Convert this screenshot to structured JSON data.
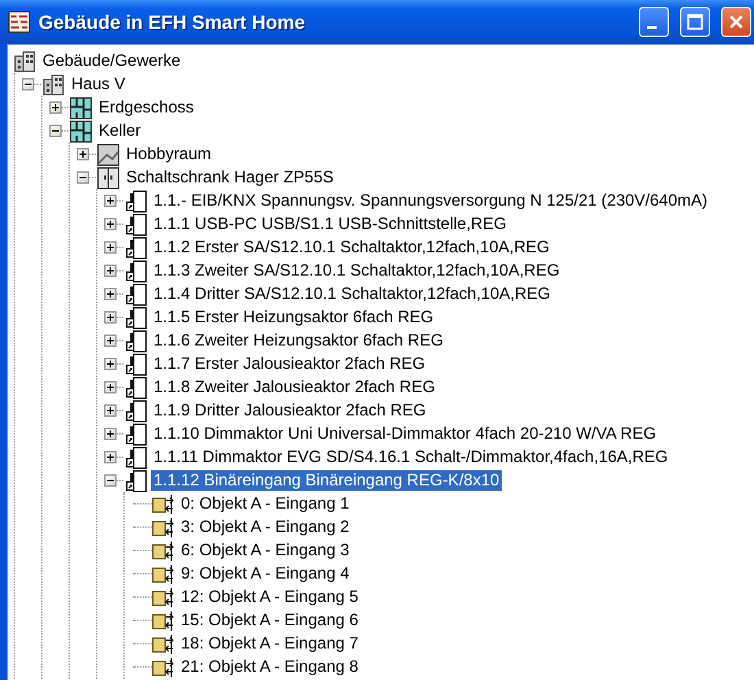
{
  "window": {
    "title": "Gebäude in EFH Smart Home"
  },
  "tree": [
    {
      "kind": "building",
      "label": "Gebäude/Gewerke",
      "selected": false,
      "children": [
        {
          "kind": "building",
          "label": "Haus V",
          "expanded": true,
          "selected": false,
          "children": [
            {
              "kind": "floor",
              "label": "Erdgeschoss",
              "expanded": false,
              "selected": false
            },
            {
              "kind": "floor",
              "label": "Keller",
              "expanded": true,
              "selected": false,
              "children": [
                {
                  "kind": "room",
                  "label": "Hobbyraum",
                  "expanded": false,
                  "selected": false
                },
                {
                  "kind": "cabinet",
                  "label": "Schaltschrank Hager ZP55S",
                  "expanded": true,
                  "selected": false,
                  "children": [
                    {
                      "kind": "device",
                      "label": "1.1.- EIB/KNX Spannungsv. Spannungsversorgung N 125/21 (230V/640mA)",
                      "expanded": false,
                      "selected": false
                    },
                    {
                      "kind": "device",
                      "label": "1.1.1 USB-PC USB/S1.1 USB-Schnittstelle,REG",
                      "expanded": false,
                      "selected": false
                    },
                    {
                      "kind": "device",
                      "label": "1.1.2 Erster SA/S12.10.1 Schaltaktor,12fach,10A,REG",
                      "expanded": false,
                      "selected": false
                    },
                    {
                      "kind": "device",
                      "label": "1.1.3 Zweiter SA/S12.10.1 Schaltaktor,12fach,10A,REG",
                      "expanded": false,
                      "selected": false
                    },
                    {
                      "kind": "device",
                      "label": "1.1.4 Dritter SA/S12.10.1 Schaltaktor,12fach,10A,REG",
                      "expanded": false,
                      "selected": false
                    },
                    {
                      "kind": "device",
                      "label": "1.1.5 Erster Heizungsaktor 6fach REG",
                      "expanded": false,
                      "selected": false
                    },
                    {
                      "kind": "device",
                      "label": "1.1.6 Zweiter Heizungsaktor 6fach REG",
                      "expanded": false,
                      "selected": false
                    },
                    {
                      "kind": "device",
                      "label": "1.1.7 Erster Jalousieaktor 2fach REG",
                      "expanded": false,
                      "selected": false
                    },
                    {
                      "kind": "device",
                      "label": "1.1.8 Zweiter Jalousieaktor 2fach REG",
                      "expanded": false,
                      "selected": false
                    },
                    {
                      "kind": "device",
                      "label": "1.1.9 Dritter Jalousieaktor 2fach REG",
                      "expanded": false,
                      "selected": false
                    },
                    {
                      "kind": "device",
                      "label": "1.1.10 Dimmaktor Uni Universal-Dimmaktor 4fach 20-210 W/VA REG",
                      "expanded": false,
                      "selected": false
                    },
                    {
                      "kind": "device",
                      "label": "1.1.11 Dimmaktor EVG SD/S4.16.1 Schalt-/Dimmaktor,4fach,16A,REG",
                      "expanded": false,
                      "selected": false
                    },
                    {
                      "kind": "device",
                      "label": "1.1.12 Binäreingang Binäreingang REG-K/8x10",
                      "expanded": true,
                      "selected": true,
                      "children": [
                        {
                          "kind": "object",
                          "label": "0: Objekt A - Eingang 1",
                          "selected": false
                        },
                        {
                          "kind": "object",
                          "label": "3: Objekt A - Eingang 2",
                          "selected": false
                        },
                        {
                          "kind": "object",
                          "label": "6: Objekt A - Eingang 3",
                          "selected": false
                        },
                        {
                          "kind": "object",
                          "label": "9: Objekt A - Eingang 4",
                          "selected": false
                        },
                        {
                          "kind": "object",
                          "label": "12: Objekt A - Eingang 5",
                          "selected": false
                        },
                        {
                          "kind": "object",
                          "label": "15: Objekt A - Eingang 6",
                          "selected": false
                        },
                        {
                          "kind": "object",
                          "label": "18: Objekt A - Eingang 7",
                          "selected": false
                        },
                        {
                          "kind": "object",
                          "label": "21: Objekt A - Eingang 8",
                          "selected": false
                        }
                      ]
                    }
                  ]
                }
              ]
            }
          ]
        }
      ]
    }
  ]
}
